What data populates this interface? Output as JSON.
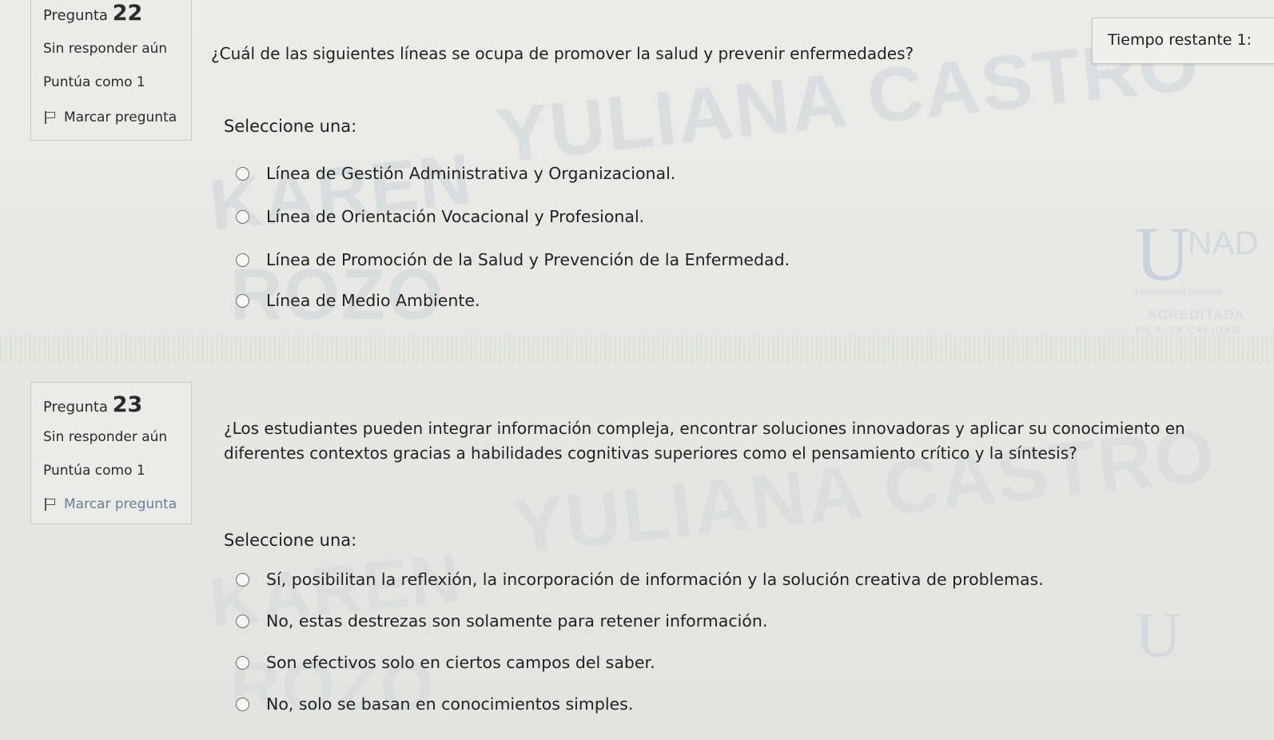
{
  "timer": {
    "label": "Tiempo restante 1:"
  },
  "watermark": {
    "line1_q22": "YULIANA CASTRO",
    "line2_q22": "KAREN",
    "line3_q22": "ROZO",
    "line1_q23": "YULIANA CASTRO",
    "line2_q23": "KAREN",
    "line3_q23": "ROZO"
  },
  "logo": {
    "letter": "U",
    "name": "NAD",
    "sub1": "Universidad Naciona",
    "sub2": "ACREDITADA",
    "sub3": "EN ALTA CALIDAD"
  },
  "questions": [
    {
      "label": "Pregunta",
      "number": "22",
      "state": "Sin responder aún",
      "mark": "Puntúa como 1",
      "flag_label": "Marcar pregunta",
      "text": "¿Cuál de las siguientes líneas se ocupa de promover la salud y prevenir enfermedades?",
      "prompt": "Seleccione una:",
      "options": [
        "Línea de Gestión Administrativa y Organizacional.",
        "Línea de Orientación Vocacional y Profesional.",
        "Línea de Promoción de la Salud y Prevención de la Enfermedad.",
        "Línea de Medio Ambiente."
      ]
    },
    {
      "label": "Pregunta",
      "number": "23",
      "state": "Sin responder aún",
      "mark": "Puntúa como 1",
      "flag_label": "Marcar pregunta",
      "text": "¿Los estudiantes pueden integrar información compleja, encontrar soluciones innovadoras y aplicar su conocimiento en diferentes contextos gracias a habilidades cognitivas superiores como el pensamiento crítico y la síntesis?",
      "prompt": "Seleccione una:",
      "options": [
        "Sí, posibilitan la reflexión, la incorporación de información y la solución creativa de problemas.",
        "No, estas destrezas son solamente para retener información.",
        "Son efectivos solo en ciertos campos del saber.",
        "No, solo se basan en conocimientos simples."
      ]
    }
  ]
}
